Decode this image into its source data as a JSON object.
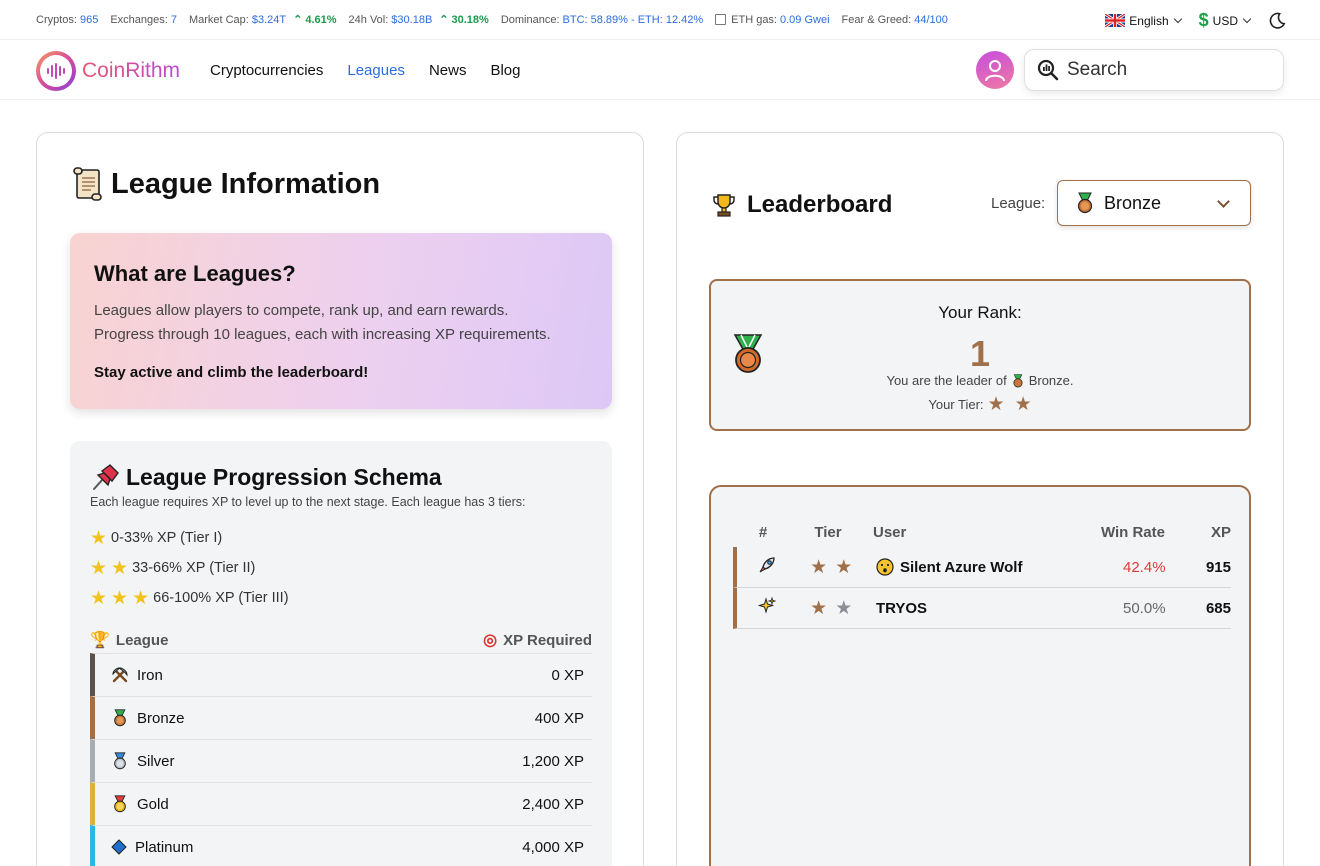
{
  "stats": {
    "cryptos_label": "Cryptos:",
    "cryptos": "965",
    "exchanges_label": "Exchanges:",
    "exchanges": "7",
    "marketcap_label": "Market Cap:",
    "marketcap": "$3.24T",
    "marketcap_change": "4.61%",
    "vol_label": "24h Vol:",
    "vol": "$30.18B",
    "vol_change": "30.18%",
    "dominance_label": "Dominance:",
    "dominance": "BTC: 58.89% - ETH: 12.42%",
    "gas_label": "ETH gas:",
    "gas": "0.09 Gwei",
    "fng_label": "Fear & Greed:",
    "fng": "44/100"
  },
  "top_right": {
    "language": "English",
    "currency": "USD"
  },
  "nav": {
    "brand": "CoinRithm",
    "links": [
      "Cryptocurrencies",
      "Leagues",
      "News",
      "Blog"
    ],
    "active": "Leagues",
    "search_placeholder": "Search"
  },
  "info": {
    "title": "League Information",
    "what_title": "What are Leagues?",
    "what_line1": "Leagues allow players to compete, rank up, and earn rewards.",
    "what_line2": "Progress through 10 leagues, each with increasing XP requirements.",
    "what_cta": "Stay active and climb the leaderboard!",
    "schema_title": "League Progression Schema",
    "schema_sub": "Each league requires XP to level up to the next stage. Each league has 3 tiers:",
    "tiers": [
      "0-33% XP (Tier I)",
      "33-66% XP (Tier II)",
      "66-100% XP (Tier III)"
    ],
    "col_league": "League",
    "col_xp": "XP Required",
    "leagues": [
      {
        "name": "Iron",
        "xp": "0 XP",
        "color": "#5b5149",
        "icon": "pickaxe-icon"
      },
      {
        "name": "Bronze",
        "xp": "400 XP",
        "color": "#a0704b",
        "icon": "bronze-medal-icon"
      },
      {
        "name": "Silver",
        "xp": "1,200 XP",
        "color": "#a8adb3",
        "icon": "silver-medal-icon"
      },
      {
        "name": "Gold",
        "xp": "2,400 XP",
        "color": "#d9b53a",
        "icon": "gold-medal-icon"
      },
      {
        "name": "Platinum",
        "xp": "4,000 XP",
        "color": "#28b8e0",
        "icon": "diamond-icon"
      }
    ]
  },
  "leaderboard": {
    "title": "Leaderboard",
    "league_label": "League:",
    "selected_league": "Bronze",
    "your_rank_label": "Your Rank:",
    "rank": "1",
    "leader_text_pre": "You are the leader of",
    "leader_league": "Bronze.",
    "tier_label": "Your Tier:",
    "columns": [
      "#",
      "Tier",
      "User",
      "Win Rate",
      "XP"
    ],
    "rows": [
      {
        "rank_icon": "rocket-icon",
        "stars_filled": 2,
        "user_icon": "surprised-face-icon",
        "user": "Silent Azure Wolf",
        "win_rate": "42.4%",
        "xp": "915",
        "win_color": "#e03b3b"
      },
      {
        "rank_icon": "sparkles-icon",
        "stars_filled": 1,
        "user_icon": "",
        "user": "TRYOS",
        "win_rate": "50.0%",
        "xp": "685",
        "win_color": "#666666"
      }
    ]
  }
}
